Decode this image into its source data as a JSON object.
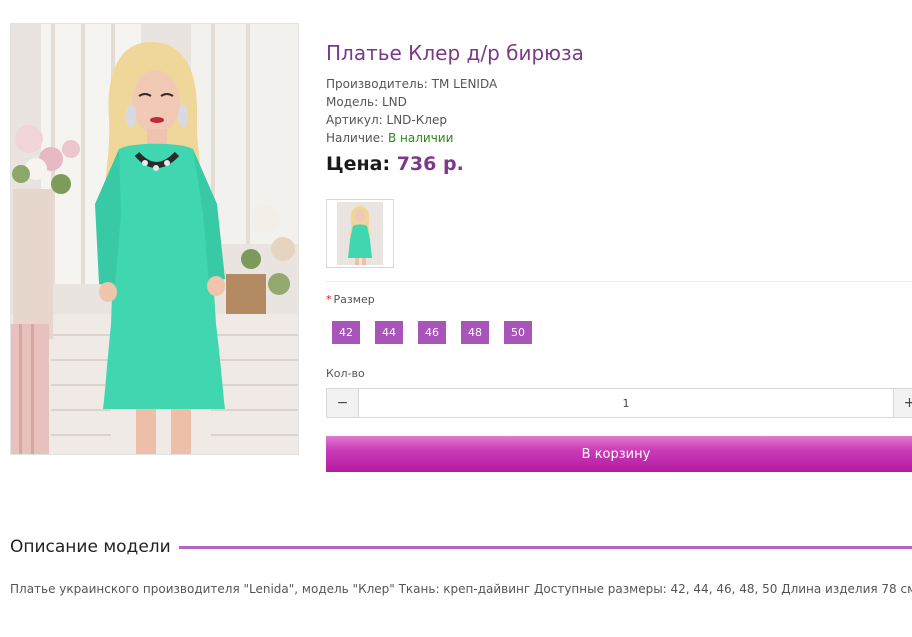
{
  "product": {
    "title": "Платье Клер д/р бирюза",
    "manufacturer_label": "Производитель:",
    "manufacturer_value": "TM LENIDA",
    "model_label": "Модель:",
    "model_value": "LND",
    "sku_label": "Артикул:",
    "sku_value": "LND-Клер",
    "availability_label": "Наличие:",
    "availability_value": "В наличии",
    "price_label": "Цена:",
    "price_value": "736 р."
  },
  "options": {
    "size_label": "Размер",
    "required_mark": "*",
    "sizes": [
      "42",
      "44",
      "46",
      "48",
      "50"
    ]
  },
  "quantity": {
    "label": "Кол-во",
    "value": "1",
    "minus": "−",
    "plus": "+"
  },
  "cart": {
    "button_label": "В корзину"
  },
  "description": {
    "heading": "Описание модели",
    "text": "Платье украинского производителя \"Lenida\", модель \"Клер\" Ткань: креп-дайвинг Доступные размеры: 42, 44, 46, 48, 50 Длина изделия 78 см"
  },
  "colors": {
    "title": "#7a3a88",
    "accent": "#a854b8",
    "in_stock": "#2a8a1a",
    "dress": "#3fd6b0"
  },
  "icons": {
    "minus": "minus-icon",
    "plus": "plus-icon"
  }
}
